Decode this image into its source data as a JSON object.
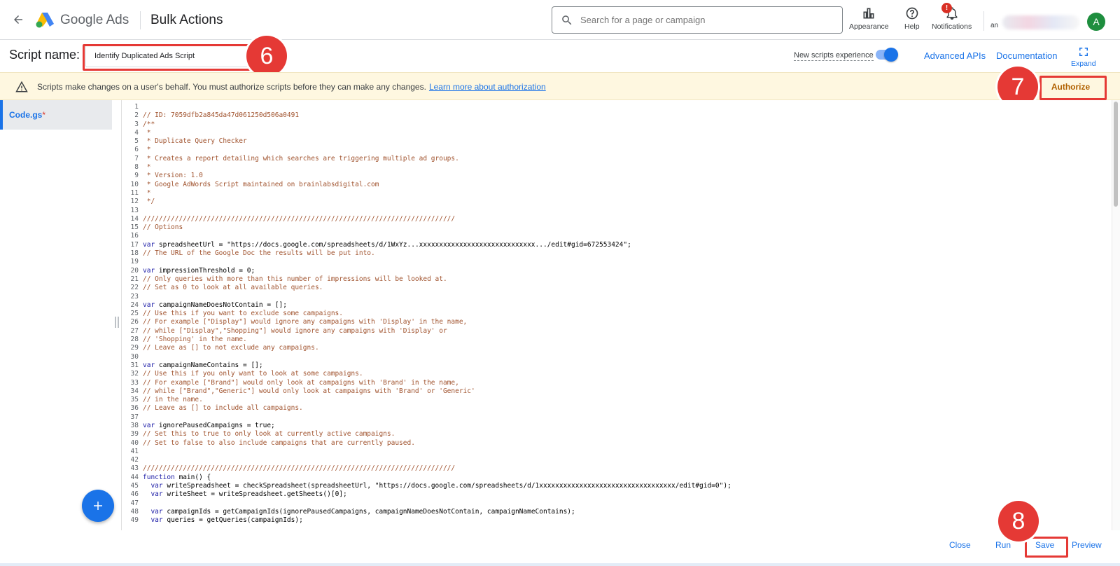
{
  "header": {
    "brand": "Google Ads",
    "page_title": "Bulk Actions",
    "search_placeholder": "Search for a page or campaign",
    "appearance_label": "Appearance",
    "help_label": "Help",
    "notifications_label": "Notifications",
    "notifications_badge": "!",
    "account_text": "an",
    "avatar_letter": "A"
  },
  "script_bar": {
    "label": "Script name:",
    "name_value": "Identify Duplicated Ads Script",
    "toggle_label": "New scripts experience",
    "toggle_on": true,
    "advanced_apis": "Advanced APIs",
    "documentation": "Documentation",
    "expand": "Expand"
  },
  "warning": {
    "text": "Scripts make changes on a user's behalf. You must authorize scripts before they can make any changes.",
    "link": "Learn more about authorization",
    "authorize_button": "Authorize"
  },
  "files": [
    {
      "name": "Code.gs",
      "modified_marker": "*"
    }
  ],
  "callouts": [
    "6",
    "7",
    "8"
  ],
  "code_lines": [
    "",
    "// ID: 7059dfb2a845da47d061250d506a0491",
    "/**",
    " *",
    " * Duplicate Query Checker",
    " *",
    " * Creates a report detailing which searches are triggering multiple ad groups.",
    " *",
    " * Version: 1.0",
    " * Google AdWords Script maintained on brainlabsdigital.com",
    " *",
    " */",
    "",
    "//////////////////////////////////////////////////////////////////////////////",
    "// Options",
    "",
    "var spreadsheetUrl = \"https://docs.google.com/spreadsheets/d/1WxYz...xxxxxxxxxxxxxxxxxxxxxxxxxxxxx.../edit#gid=672553424\";",
    "// The URL of the Google Doc the results will be put into.",
    "",
    "var impressionThreshold = 0;",
    "// Only queries with more than this number of impressions will be looked at.",
    "// Set as 0 to look at all available queries.",
    "",
    "var campaignNameDoesNotContain = [];",
    "// Use this if you want to exclude some campaigns.",
    "// For example [\"Display\"] would ignore any campaigns with 'Display' in the name,",
    "// while [\"Display\",\"Shopping\"] would ignore any campaigns with 'Display' or",
    "// 'Shopping' in the name.",
    "// Leave as [] to not exclude any campaigns.",
    "",
    "var campaignNameContains = [];",
    "// Use this if you only want to look at some campaigns.",
    "// For example [\"Brand\"] would only look at campaigns with 'Brand' in the name,",
    "// while [\"Brand\",\"Generic\"] would only look at campaigns with 'Brand' or 'Generic'",
    "// in the name.",
    "// Leave as [] to include all campaigns.",
    "",
    "var ignorePausedCampaigns = true;",
    "// Set this to true to only look at currently active campaigns.",
    "// Set to false to also include campaigns that are currently paused.",
    "",
    "",
    "//////////////////////////////////////////////////////////////////////////////",
    "function main() {",
    "  var writeSpreadsheet = checkSpreadsheet(spreadsheetUrl, \"https://docs.google.com/spreadsheets/d/1xxxxxxxxxxxxxxxxxxxxxxxxxxxxxxxxxx/edit#gid=0\");",
    "  var writeSheet = writeSpreadsheet.getSheets()[0];",
    "",
    "  var campaignIds = getCampaignIds(ignorePausedCampaigns, campaignNameDoesNotContain, campaignNameContains);",
    "  var queries = getQueries(campaignIds);"
  ],
  "footer": {
    "close": "Close",
    "run": "Run",
    "save": "Save",
    "preview": "Preview"
  }
}
